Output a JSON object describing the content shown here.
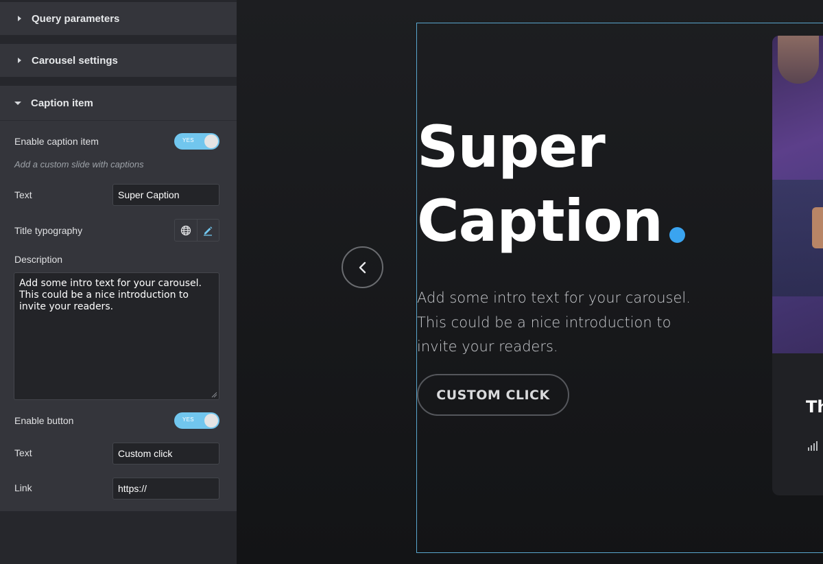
{
  "sidebar": {
    "sections": {
      "query": "Query parameters",
      "carousel": "Carousel settings",
      "caption": "Caption item"
    },
    "enable_caption_label": "Enable caption item",
    "toggle_yes": "YES",
    "hint": "Add a custom slide with captions",
    "text_label": "Text",
    "text_value": "Super Caption",
    "title_typography_label": "Title typography",
    "description_label": "Description",
    "description_value": "Add some intro text for your carousel. This could be a nice introduction to invite your readers.",
    "enable_button_label": "Enable button",
    "button_text_label": "Text",
    "button_text_value": "Custom click",
    "link_label": "Link",
    "link_value": "https://"
  },
  "preview": {
    "headline_line1": "Super",
    "headline_line2": "Caption",
    "description": "Add some intro text for your carousel. This could be a nice introduction to invite your readers.",
    "cta": "CUSTOM CLICK",
    "card_title": "Th"
  },
  "colors": {
    "accent": "#71c6ee",
    "dot": "#3aa4f0",
    "frame": "#5aa7cf"
  },
  "icons": [
    "chevron-left-icon",
    "globe-icon",
    "pencil-icon",
    "bar-chart-icon",
    "caret-right-icon",
    "caret-down-icon"
  ]
}
